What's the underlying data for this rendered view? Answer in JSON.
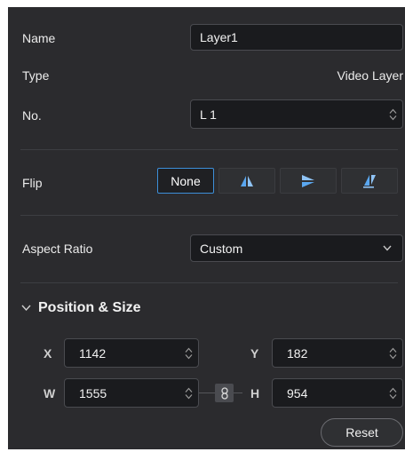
{
  "fields": {
    "name_label": "Name",
    "name_value": "Layer1",
    "type_label": "Type",
    "type_value": "Video Layer",
    "no_label": "No.",
    "no_value": "L 1"
  },
  "flip": {
    "label": "Flip",
    "options": [
      "None",
      "flip-horizontal-icon",
      "flip-vertical-icon",
      "flip-both-icon"
    ],
    "none_label": "None",
    "selected": "None"
  },
  "aspect": {
    "label": "Aspect Ratio",
    "value": "Custom"
  },
  "position_size": {
    "title": "Position & Size",
    "x_label": "X",
    "x_value": "1142",
    "y_label": "Y",
    "y_value": "182",
    "w_label": "W",
    "w_value": "1555",
    "h_label": "H",
    "h_value": "954",
    "reset_label": "Reset"
  },
  "colors": {
    "panel_bg": "#2b2b2e",
    "input_bg": "#1a1b1e",
    "accent": "#3d8fd9"
  }
}
